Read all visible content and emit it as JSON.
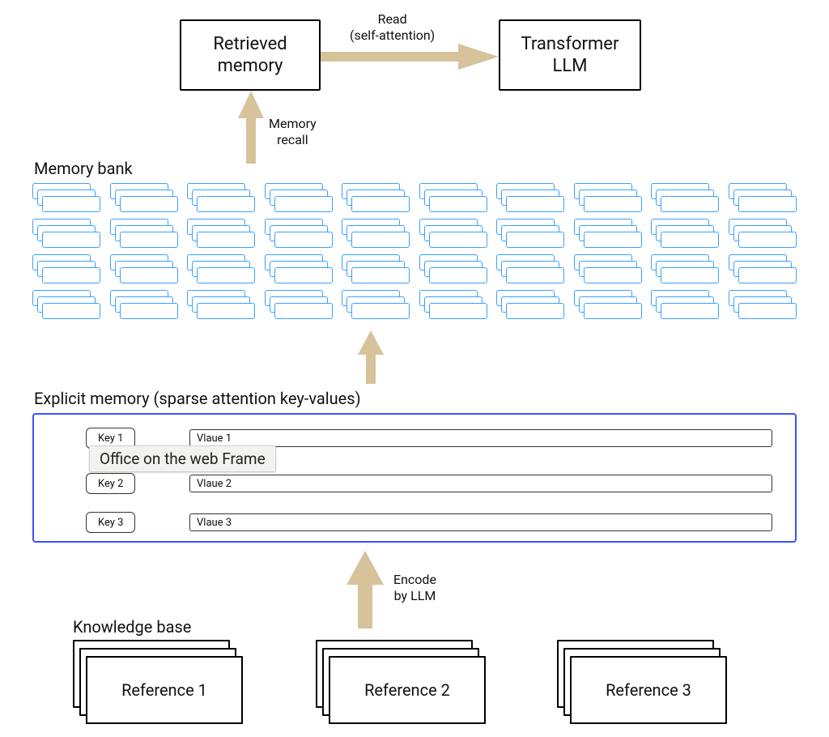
{
  "colors": {
    "arrow": "#d6c39a",
    "blue_panel": "#3a52ff",
    "memory_tile": "#3aa0ff"
  },
  "top_boxes": {
    "retrieved_memory": "Retrieved\nmemory",
    "transformer_llm": "Transformer\nLLM"
  },
  "arrows": {
    "read": "Read\n(self-attention)",
    "memory_recall": "Memory\nrecall",
    "encode": "Encode\nby LLM"
  },
  "sections": {
    "memory_bank": "Memory bank",
    "explicit_memory": "Explicit memory (sparse attention key-values)",
    "knowledge_base": "Knowledge base"
  },
  "memory_bank": {
    "rows": 4,
    "groups_per_row": 10
  },
  "explicit_memory": {
    "pairs": [
      {
        "key": "Key 1",
        "value": "Vlaue 1"
      },
      {
        "key": "Key 2",
        "value": "Vlaue 2"
      },
      {
        "key": "Key 3",
        "value": "Vlaue 3"
      }
    ]
  },
  "tooltip": "Office on the web Frame",
  "knowledge_base": {
    "references": [
      "Reference 1",
      "Reference 2",
      "Reference 3"
    ]
  },
  "chart_data": {
    "type": "diagram",
    "title": "Memory-augmented LLM architecture",
    "nodes": [
      {
        "id": "kb",
        "label": "Knowledge base",
        "children": [
          "Reference 1",
          "Reference 2",
          "Reference 3"
        ]
      },
      {
        "id": "explicit_memory",
        "label": "Explicit memory (sparse attention key-values)",
        "entries": [
          [
            "Key 1",
            "Vlaue 1"
          ],
          [
            "Key 2",
            "Vlaue 2"
          ],
          [
            "Key 3",
            "Vlaue 3"
          ]
        ]
      },
      {
        "id": "memory_bank",
        "label": "Memory bank"
      },
      {
        "id": "retrieved_memory",
        "label": "Retrieved memory"
      },
      {
        "id": "transformer_llm",
        "label": "Transformer LLM"
      }
    ],
    "edges": [
      {
        "from": "kb",
        "to": "explicit_memory",
        "label": "Encode by LLM"
      },
      {
        "from": "explicit_memory",
        "to": "memory_bank",
        "label": ""
      },
      {
        "from": "memory_bank",
        "to": "retrieved_memory",
        "label": "Memory recall"
      },
      {
        "from": "retrieved_memory",
        "to": "transformer_llm",
        "label": "Read (self-attention)"
      }
    ]
  }
}
